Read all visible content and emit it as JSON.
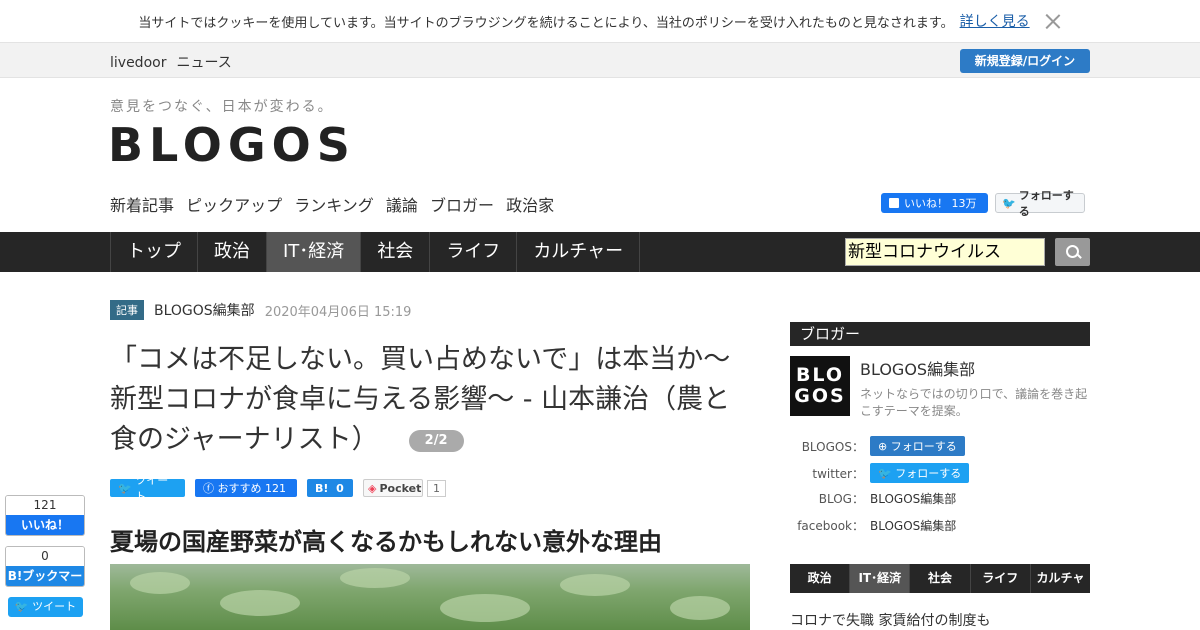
{
  "cookie": {
    "message": "当サイトではクッキーを使用しています。当サイトのブラウジングを続けることにより、当社のポリシーを受け入れたものと見なされます。",
    "more_link": "詳しく見る"
  },
  "topbar": {
    "brand": "livedoor",
    "section": "ニュース",
    "login_label": "新規登録/ログイン"
  },
  "header": {
    "tagline": "意見をつなぐ、日本が変わる。",
    "logo": "BLOGOS",
    "nav": [
      "新着記事",
      "ピックアップ",
      "ランキング",
      "議論",
      "ブロガー",
      "政治家"
    ],
    "fb_like_label": "いいね！ 13万",
    "tw_follow_label": "フォローする"
  },
  "main_nav": {
    "items": [
      "トップ",
      "政治",
      "IT･経済",
      "社会",
      "ライフ",
      "カルチャー"
    ],
    "active_index": 2,
    "search_value": "新型コロナウイルス"
  },
  "article": {
    "tag": "記事",
    "author": "BLOGOS編集部",
    "date": "2020年04月06日 15:19",
    "title": "「コメは不足しない。買い占めないで」は本当か～新型コロナが食卓に与える影響～ - 山本謙治（農と食のジャーナリスト）",
    "page_indicator": "2/2",
    "share": {
      "tweet": "ツイート",
      "fb_recommend": "おすすめ 121",
      "hatena_count": "0",
      "pocket_label": "Pocket",
      "pocket_count": "1"
    },
    "subheading": "夏場の国産野菜が高くなるかもしれない意外な理由"
  },
  "floating_share": {
    "fb_count": "121",
    "fb_label": "いいね！",
    "hatena_count": "0",
    "hatena_label": "B!ブックマーク",
    "tweet_label": "ツイート"
  },
  "sidebar": {
    "heading": "ブロガー",
    "avatar_text_1": "BLO",
    "avatar_text_2": "GOS",
    "name": "BLOGOS編集部",
    "description": "ネットならではの切り口で、議論を巻き起こすテーマを提案。",
    "rows": [
      {
        "label": "BLOGOS：",
        "value": "フォローする"
      },
      {
        "label": "twitter：",
        "value": "フォローする"
      },
      {
        "label": "BLOG：",
        "value": "BLOGOS編集部"
      },
      {
        "label": "facebook：",
        "value": "BLOGOS編集部"
      }
    ],
    "tabs": [
      "政治",
      "IT･経済",
      "社会",
      "ライフ",
      "カルチャー"
    ],
    "active_tab": 1,
    "first_item": "コロナで失職 家賃給付の制度も"
  },
  "colors": {
    "nav_bg": "#262626",
    "active_tab": "#555555",
    "login_blue": "#2d7bc6",
    "facebook": "#1877f2",
    "twitter": "#1da1f2"
  }
}
